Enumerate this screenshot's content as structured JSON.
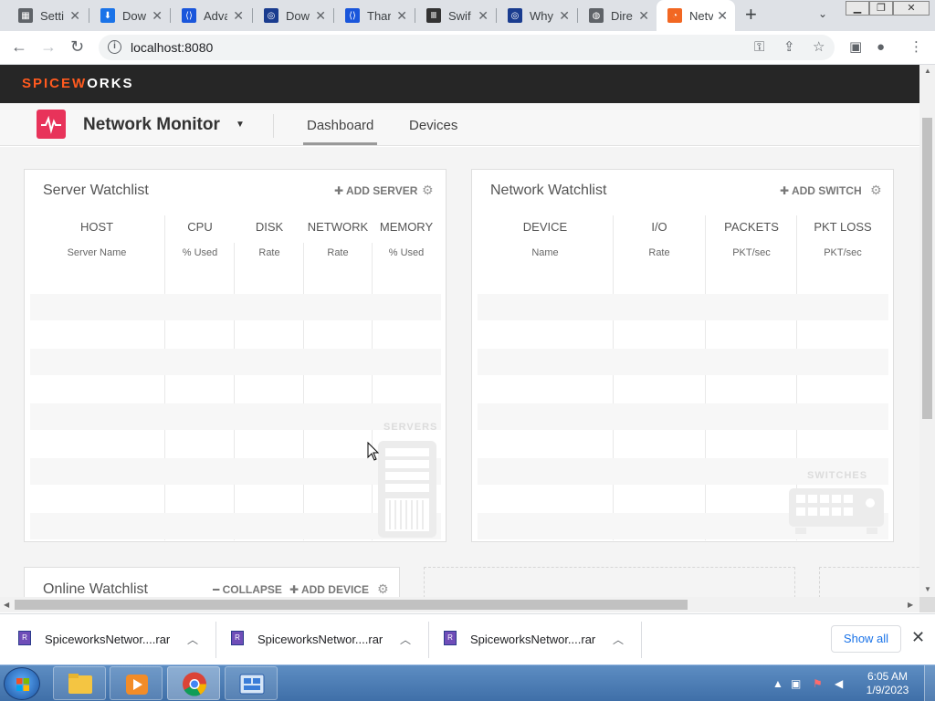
{
  "browser": {
    "tabs": [
      {
        "title": "Setti",
        "icon": "settings-icon",
        "color": "#5f6368"
      },
      {
        "title": "Dow",
        "icon": "download-icon",
        "color": "#1a73e8"
      },
      {
        "title": "Adva",
        "icon": "code-icon",
        "color": "#1a56db"
      },
      {
        "title": "Dow",
        "icon": "globe-icon",
        "color": "#1a3c8f"
      },
      {
        "title": "Thar",
        "icon": "code-icon",
        "color": "#1a56db"
      },
      {
        "title": "Swif",
        "icon": "institution-icon",
        "color": "#333333"
      },
      {
        "title": "Why",
        "icon": "globe-icon",
        "color": "#1a3c8f"
      },
      {
        "title": "Dire",
        "icon": "globe-icon",
        "color": "#5f6368"
      },
      {
        "title": "Netv",
        "icon": "spiceworks-icon",
        "color": "#f26722",
        "active": true
      }
    ],
    "url": "localhost:8080"
  },
  "app": {
    "brand_left": "SPICEW",
    "brand_mid": "O",
    "brand_right": "RKS",
    "title": "Network Monitor",
    "nav": [
      "Dashboard",
      "Devices"
    ],
    "active_nav": "Dashboard",
    "accent": "#e8335a"
  },
  "server_watchlist": {
    "title": "Server Watchlist",
    "action": "ADD SERVER",
    "columns": [
      {
        "head": "HOST",
        "sub": "Server Name"
      },
      {
        "head": "CPU",
        "sub": "% Used"
      },
      {
        "head": "DISK",
        "sub": "Rate"
      },
      {
        "head": "NETWORK",
        "sub": "Rate"
      },
      {
        "head": "MEMORY",
        "sub": "% Used"
      }
    ],
    "placeholder": "SERVERS"
  },
  "network_watchlist": {
    "title": "Network Watchlist",
    "action": "ADD SWITCH",
    "columns": [
      {
        "head": "DEVICE",
        "sub": "Name"
      },
      {
        "head": "I/O",
        "sub": "Rate"
      },
      {
        "head": "PACKETS",
        "sub": "PKT/sec"
      },
      {
        "head": "PKT LOSS",
        "sub": "PKT/sec"
      }
    ],
    "placeholder": "SWITCHES"
  },
  "online_watchlist": {
    "title": "Online Watchlist",
    "collapse": "COLLAPSE",
    "action": "ADD DEVICE"
  },
  "downloads": {
    "items": [
      {
        "name": "SpiceworksNetwor....rar"
      },
      {
        "name": "SpiceworksNetwor....rar"
      },
      {
        "name": "SpiceworksNetwor....rar"
      }
    ],
    "show_all": "Show all"
  },
  "taskbar": {
    "time": "6:05 AM",
    "date": "1/9/2023"
  }
}
